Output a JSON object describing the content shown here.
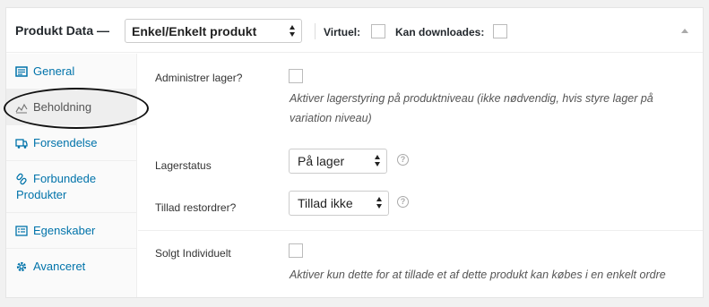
{
  "header": {
    "title": "Produkt Data —",
    "product_type": "Enkel/Enkelt produkt",
    "virtual_label": "Virtuel:",
    "downloadable_label": "Kan downloades:"
  },
  "sidebar": {
    "items": [
      {
        "label": "General",
        "icon": "general-icon"
      },
      {
        "label": "Beholdning",
        "icon": "inventory-icon"
      },
      {
        "label": "Forsendelse",
        "icon": "shipping-icon"
      },
      {
        "label": "Forbundede Produkter",
        "icon": "linked-products-icon"
      },
      {
        "label": "Egenskaber",
        "icon": "attributes-icon"
      },
      {
        "label": "Avanceret",
        "icon": "advanced-icon"
      }
    ]
  },
  "fields": {
    "manage_stock_label": "Administrer lager?",
    "manage_stock_desc": "Aktiver lagerstyring på produktniveau (ikke nødvendig, hvis styre lager på variation niveau)",
    "stock_status_label": "Lagerstatus",
    "stock_status_value": "På lager",
    "backorders_label": "Tillad restordrer?",
    "backorders_value": "Tillad ikke",
    "sold_individually_label": "Solgt Individuelt",
    "sold_individually_desc": "Aktiver kun dette for at tillade et af dette produkt kan købes i en enkelt ordre",
    "help_glyph": "?"
  },
  "colors": {
    "link": "#0073aa",
    "border": "#eeeeee"
  }
}
